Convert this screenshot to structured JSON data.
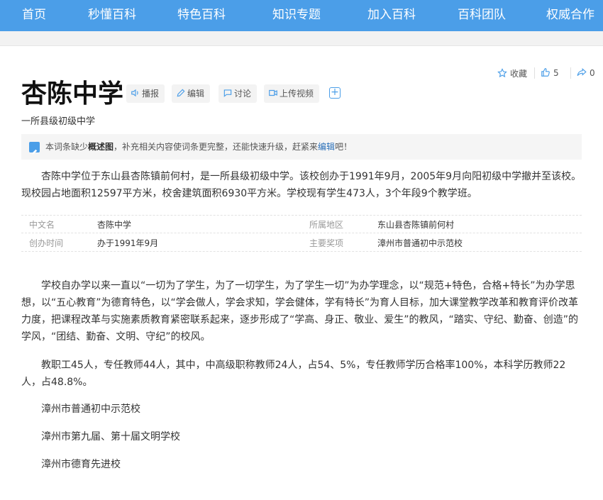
{
  "nav": {
    "items": [
      {
        "label": "首页"
      },
      {
        "label": "秒懂百科"
      },
      {
        "label": "特色百科"
      },
      {
        "label": "知识专题"
      },
      {
        "label": "加入百科"
      },
      {
        "label": "百科团队"
      },
      {
        "label": "权威合作"
      }
    ]
  },
  "actions": {
    "collect_label": "收藏",
    "like_count": "5",
    "share_count": "0"
  },
  "entry": {
    "title": "杏陈中学",
    "subtitle": "一所县级初级中学",
    "toolbar": {
      "broadcast": "播报",
      "edit": "编辑",
      "discuss": "讨论",
      "upload_video": "上传视频"
    }
  },
  "notice": {
    "prefix": "本词条缺少",
    "bold": "概述图",
    "middle": "，补充相关内容使词条更完整，还能快速升级，赶紧来",
    "link": "编辑",
    "suffix": "吧！"
  },
  "summary": "杏陈中学位于东山县杏陈镇前何村，是一所县级初级中学。该校创办于1991年9月，2005年9月向阳初级中学撤并至该校。现校园占地面积12597平方米，校舍建筑面积6930平方米。学校现有学生473人，3个年段9个教学班。",
  "infobox": [
    {
      "k1": "中文名",
      "v1": "杏陈中学",
      "k2": "所属地区",
      "v2": "东山县杏陈镇前何村"
    },
    {
      "k1": "创办时间",
      "v1": "办于1991年9月",
      "k2": "主要奖项",
      "v2": "漳州市普通初中示范校"
    }
  ],
  "body": {
    "p1": "学校自办学以来一直以“一切为了学生，为了一切学生，为了学生一切”为办学理念，以“规范+特色，合格+特长”为办学思想，以“五心教育”为德育特色，以“学会做人，学会求知，学会健体，学有特长”为育人目标，加大课堂教学改革和教育评价改革力度，把课程改革与实施素质教育紧密联系起来，逐步形成了“学高、身正、敬业、爱生”的教风，“踏实、守纪、勤奋、创造”的学风，“团结、勤奋、文明、守纪”的校风。",
    "p2": "教职工45人，专任教师44人，其中，中高级职称教师24人，占54、5%，专任教师学历合格率100%，本科学历教师22人，占48.8%。",
    "honors": [
      "漳州市普通初中示范校",
      "漳州市第九届、第十届文明学校",
      "漳州市德育先进校"
    ]
  },
  "colors": {
    "nav_bg": "#4b9ee8",
    "accent": "#4b9ee8",
    "link": "#2a6fb8"
  }
}
